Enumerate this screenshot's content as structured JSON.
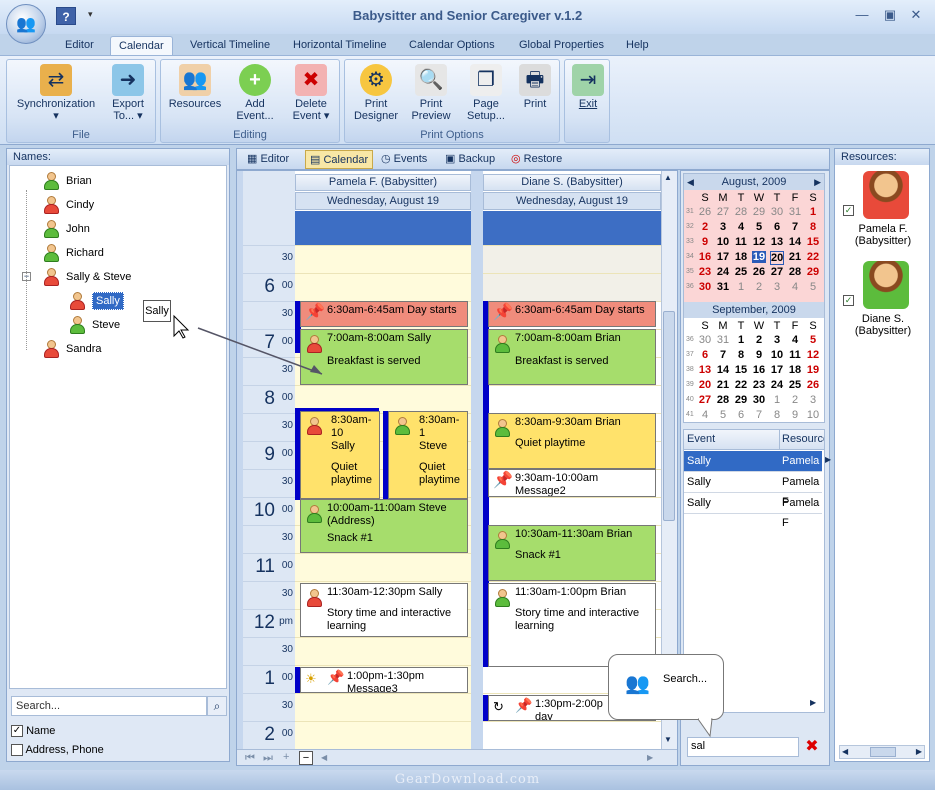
{
  "app": {
    "title": "Babysitter and Senior Caregiver v.1.2"
  },
  "qat": {
    "help": "?",
    "more": "▾"
  },
  "window": {
    "minimize": "—",
    "maximize": "▣",
    "close": "✕"
  },
  "ribbon_tabs": [
    "Editor",
    "Calendar",
    "Vertical Timeline",
    "Horizontal Timeline",
    "Calendar Options",
    "Global Properties",
    "Help"
  ],
  "ribbon": {
    "groups": {
      "file": "File",
      "editing": "Editing",
      "print": "Print Options"
    },
    "sync": {
      "l1": "Synchronization",
      "l2": "▾"
    },
    "export": {
      "l1": "Export",
      "l2": "To... ▾"
    },
    "resources": {
      "l1": "Resources"
    },
    "add_event": {
      "l1": "Add",
      "l2": "Event..."
    },
    "delete_event": {
      "l1": "Delete",
      "l2": "Event ▾"
    },
    "print_designer": {
      "l1": "Print",
      "l2": "Designer"
    },
    "print_preview": {
      "l1": "Print",
      "l2": "Preview"
    },
    "page_setup": {
      "l1": "Page",
      "l2": "Setup..."
    },
    "print": {
      "l1": "Print"
    },
    "exit": {
      "l1": "Exit"
    }
  },
  "names_panel": {
    "title": "Names:",
    "items": [
      "Brian",
      "Cindy",
      "John",
      "Richard",
      "Sally & Steve",
      "Sally",
      "Steve",
      "Sandra"
    ],
    "expander": "−",
    "drag_tooltip": "Sally",
    "search_placeholder": "Search...",
    "opt_name": "Name",
    "opt_address": "Address, Phone",
    "check": "✓"
  },
  "cal_tabs": [
    "Editor",
    "Calendar",
    "Events",
    "Backup",
    "Restore"
  ],
  "columns": [
    {
      "resource": "Pamela F. (Babysitter)",
      "date": "Wednesday, August 19"
    },
    {
      "resource": "Diane S. (Babysitter)",
      "date": "Wednesday, August 19"
    }
  ],
  "hours": [
    {
      "h": "",
      "m": "30"
    },
    {
      "h": "6",
      "m": "00"
    },
    {
      "h": "",
      "m": "30"
    },
    {
      "h": "7",
      "m": "00"
    },
    {
      "h": "",
      "m": "30"
    },
    {
      "h": "8",
      "m": "00"
    },
    {
      "h": "",
      "m": "30"
    },
    {
      "h": "9",
      "m": "00"
    },
    {
      "h": "",
      "m": "30"
    },
    {
      "h": "10",
      "m": "00"
    },
    {
      "h": "",
      "m": "30"
    },
    {
      "h": "11",
      "m": "00"
    },
    {
      "h": "",
      "m": "30"
    },
    {
      "h": "12",
      "m": "pm"
    },
    {
      "h": "",
      "m": "30"
    },
    {
      "h": "1",
      "m": "00"
    },
    {
      "h": "",
      "m": "30"
    },
    {
      "h": "2",
      "m": "00"
    }
  ],
  "events": {
    "p1": {
      "t": "6:30am-6:45am Day starts",
      "s": ""
    },
    "p2": {
      "t": "7:00am-8:00am Sally",
      "s": "Breakfast is served"
    },
    "p3": {
      "t": "8:30am-10",
      "t2": "Sally",
      "s": "Quiet playtime"
    },
    "p4": {
      "t": "8:30am-1",
      "t2": "Steve",
      "s": "Quiet playtime"
    },
    "p5": {
      "t": "10:00am-11:00am Steve (Address)",
      "s": "Snack #1"
    },
    "p6": {
      "t": "11:30am-12:30pm Sally",
      "s": "Story time and interactive learning"
    },
    "p7": {
      "t": "1:00pm-1:30pm",
      "s": "Message3"
    },
    "d1": {
      "t": "6:30am-6:45am Day starts",
      "s": ""
    },
    "d2": {
      "t": "7:00am-8:00am Brian",
      "s": "Breakfast is served"
    },
    "d3": {
      "t": "8:30am-9:30am Brian",
      "s": "Quiet playtime"
    },
    "d4": {
      "t": "9:30am-10:00am Message2",
      "s": ""
    },
    "d5": {
      "t": "10:30am-11:30am Brian",
      "s": "Snack #1"
    },
    "d6": {
      "t": "11:30am-1:00pm Brian",
      "s": "Story time and interactive learning"
    },
    "d7": {
      "t": "1:30pm-2:00p",
      "s": "day"
    }
  },
  "search_balloon": "Search...",
  "minical": {
    "aug": {
      "title": "August, 2009",
      "prev": "◀",
      "next": "▶"
    },
    "sep": {
      "title": "September, 2009"
    },
    "dow": [
      "S",
      "M",
      "T",
      "W",
      "T",
      "F",
      "S"
    ]
  },
  "event_list": {
    "headers": [
      "Event",
      "Resource"
    ],
    "rows": [
      {
        "e": "Sally",
        "r": "Pamela F"
      },
      {
        "e": "Sally",
        "r": "Pamela F"
      },
      {
        "e": "Sally",
        "r": "Pamela F"
      }
    ],
    "search_value": "sal",
    "clear": "✖"
  },
  "resources_panel": {
    "title": "Resources:",
    "items": [
      {
        "name": "Pamela F.",
        "role": "(Babysitter)"
      },
      {
        "name": "Diane S.",
        "role": "(Babysitter)"
      }
    ]
  },
  "nav": {
    "first": "⏮",
    "last": "⏭",
    "add": "+",
    "remove": "−",
    "left": "◀",
    "right": "▶",
    "up": "▲",
    "down": "▼"
  },
  "watermark": "GearDownload.com",
  "colors": {
    "selected": "#316ac5",
    "blue_bar": "#0000c8"
  }
}
